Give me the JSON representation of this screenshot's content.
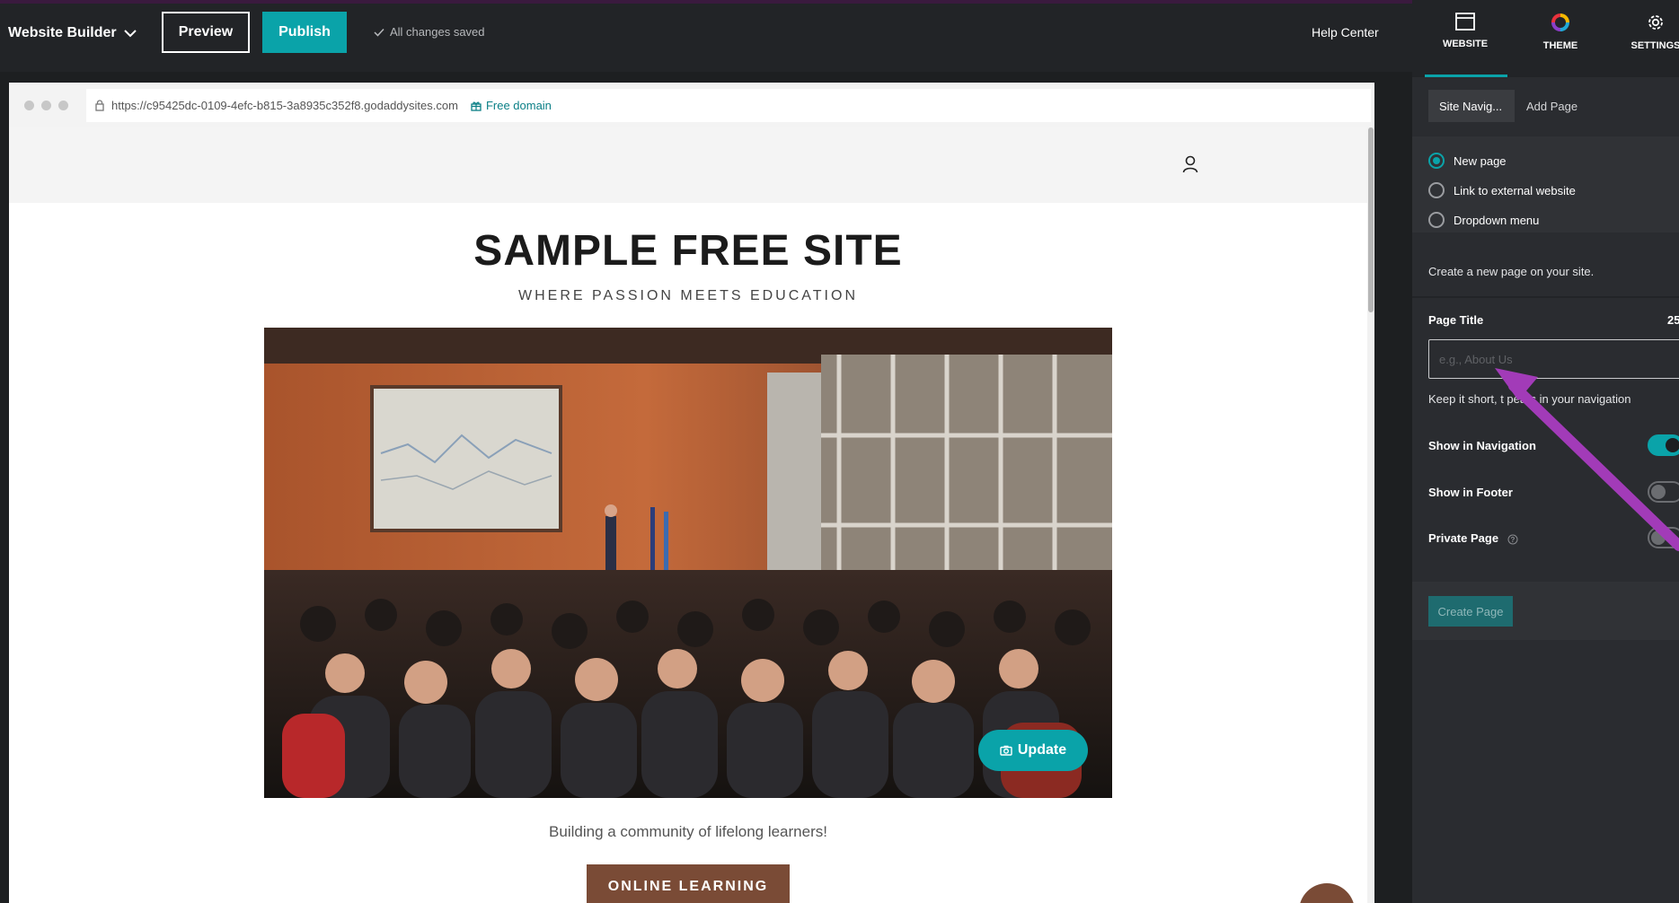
{
  "topbar": {
    "brand": "Website Builder",
    "preview_label": "Preview",
    "publish_label": "Publish",
    "saved_status": "All changes saved",
    "help_label": "Help Center"
  },
  "browser": {
    "url": "https://c95425dc-0109-4efc-b815-3a8935c352f8.godaddysites.com",
    "free_domain": "Free domain"
  },
  "site": {
    "title": "SAMPLE FREE SITE",
    "tagline": "WHERE PASSION MEETS EDUCATION",
    "update_label": "Update",
    "community_text": "Building a community of lifelong learners!",
    "cta_label": "ONLINE LEARNING"
  },
  "panel": {
    "tabs": [
      {
        "label": "WEBSITE",
        "icon": "browser-window-icon"
      },
      {
        "label": "THEME",
        "icon": "color-wheel-icon"
      },
      {
        "label": "SETTINGS",
        "icon": "gear-icon"
      }
    ],
    "crumbs": [
      "Site Navig...",
      "Add Page"
    ],
    "options": [
      "New page",
      "Link to external website",
      "Dropdown menu"
    ],
    "selected_option": "New page",
    "description": "Create a new page on your site.",
    "page_title_label": "Page Title",
    "char_count": "25",
    "page_title_value": "",
    "page_title_placeholder": "e.g., About Us",
    "hint_text": "Keep it short, t      pears in your navigation",
    "show_in_navigation_label": "Show in Navigation",
    "show_in_navigation": true,
    "show_in_footer_label": "Show in Footer",
    "show_in_footer": false,
    "private_page_label": "Private Page",
    "private_page": false,
    "create_label": "Create Page"
  },
  "colors": {
    "accent": "#0aa3a9",
    "brown": "#7a4b36",
    "annotation_arrow": "#a23bb8"
  }
}
